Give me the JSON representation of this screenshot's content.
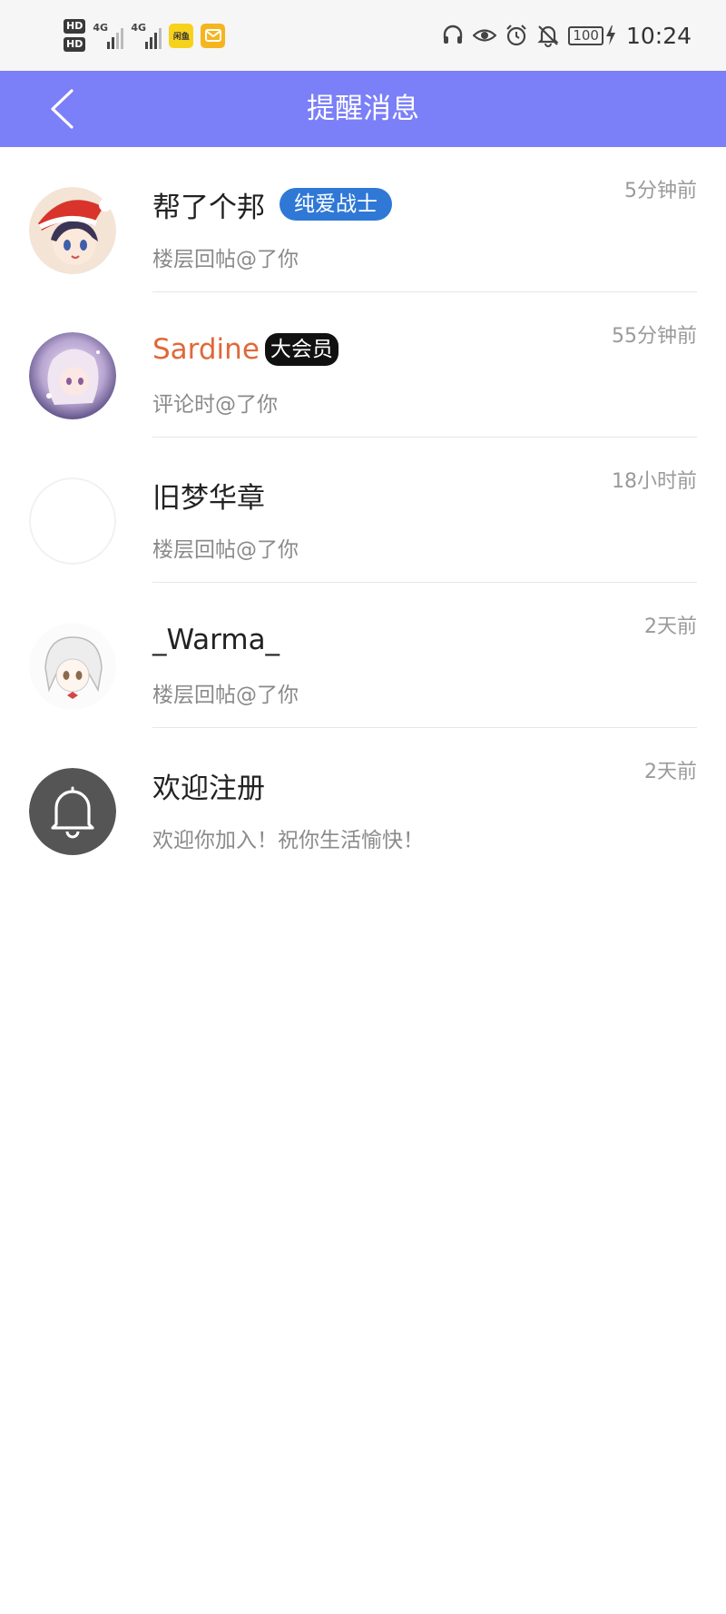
{
  "status_bar": {
    "hd1": "HD",
    "hd2": "HD",
    "sim1_network": "4G",
    "sim2_network": "4G",
    "app_icon_a_label": "闲鱼",
    "battery_level": "100",
    "time": "10:24",
    "icons": [
      "headphones-icon",
      "eye-icon",
      "alarm-icon",
      "bell-muted-icon",
      "battery-icon",
      "charging-icon"
    ]
  },
  "header": {
    "title": "提醒消息",
    "background_color": "#7b7ff8"
  },
  "notifications": [
    {
      "name": "帮了个邦",
      "tag": "纯爱战士",
      "tag_color": "#2f78d6",
      "message": "楼层回帖@了你",
      "time": "5分钟前"
    },
    {
      "name": "Sardine",
      "name_color": "#e0683a",
      "tag": "大会员",
      "tag_color": "#111111",
      "message": "评论时@了你",
      "time": "55分钟前"
    },
    {
      "name": "旧梦华章",
      "message": "楼层回帖@了你",
      "time": "18小时前"
    },
    {
      "name": "_Warma_",
      "message": "楼层回帖@了你",
      "time": "2天前"
    },
    {
      "name": "欢迎注册",
      "message": "欢迎你加入！祝你生活愉快！",
      "time": "2天前",
      "icon": "bell-icon"
    }
  ]
}
